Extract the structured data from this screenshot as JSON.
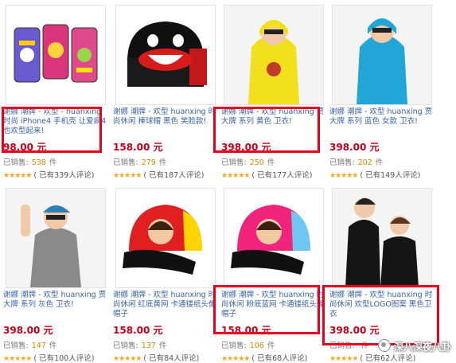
{
  "products": [
    {
      "title": "谢娜 潮牌 - 欢型 - huanxing 时尚 iPhone4 手机壳 让爱疯4也欢型起来!",
      "price": "98.00 元",
      "sold_label": "已销售:",
      "sold_count": "538",
      "sold_unit": "件",
      "stars": "★★★★★",
      "reviews": "( 已有339人评论)"
    },
    {
      "title": "谢娜 潮牌 - 欢型 huanxing 时尚休闲 棒球帽 黑色 笑脸款!",
      "price": "158.00 元",
      "sold_label": "已销售:",
      "sold_count": "279",
      "sold_unit": "件",
      "stars": "★★★★★",
      "reviews": "( 已有187人评论)"
    },
    {
      "title": "谢娜 潮牌 - 欢型 huanxing 贾大牌 系列 黄色 卫衣!",
      "price": "398.00 元",
      "sold_label": "已销售:",
      "sold_count": "250",
      "sold_unit": "件",
      "stars": "★★★★★",
      "reviews": "( 已有177人评论)"
    },
    {
      "title": "谢娜 潮牌 - 欢型 huanxing 贾大牌 系列 蓝色 女款 卫衣!",
      "price": "398.00 元",
      "sold_label": "已销售:",
      "sold_count": "202",
      "sold_unit": "件",
      "stars": "★★★★★",
      "reviews": "( 已有149人评论)"
    },
    {
      "title": "谢娜 潮牌 - 欢型 huanxing 贾大牌 系列 灰色 卫衣!",
      "price": "398.00 元",
      "sold_label": "已销售:",
      "sold_count": "147",
      "sold_unit": "件",
      "stars": "★★★★★",
      "reviews": "( 已有100人评论)"
    },
    {
      "title": "谢娜 潮牌 - 欢型 huanxing 时尚休闲 红底黄网 卡通镂纸头像帽子",
      "price": "158.00 元",
      "sold_label": "已销售:",
      "sold_count": "137",
      "sold_unit": "件",
      "stars": "★★★★★",
      "reviews": "( 已有84人评论)"
    },
    {
      "title": "谢娜 潮牌 - 欢型 huanxing 时尚休闲 粉底蓝网 卡通镂纸头像帽子",
      "price": "158.00 元",
      "sold_label": "已销售:",
      "sold_count": "106",
      "sold_unit": "件",
      "stars": "★★★★★",
      "reviews": "( 已有68人评论)"
    },
    {
      "title": "谢娜 潮牌 - 欢型 huanxing 时尚休闲 欢型LOGO图案 黑色卫衣",
      "price": "398.00 元",
      "sold_label": "已销售:",
      "sold_count": "",
      "sold_unit": "件",
      "stars": "★★★★★",
      "reviews": "( 已有62人评论)"
    }
  ],
  "watermark": "深八深夜八卦",
  "colors": {
    "link": "#3a61a8",
    "price": "#c4001a",
    "highlight": "#e8001c",
    "star": "#f5a623"
  }
}
